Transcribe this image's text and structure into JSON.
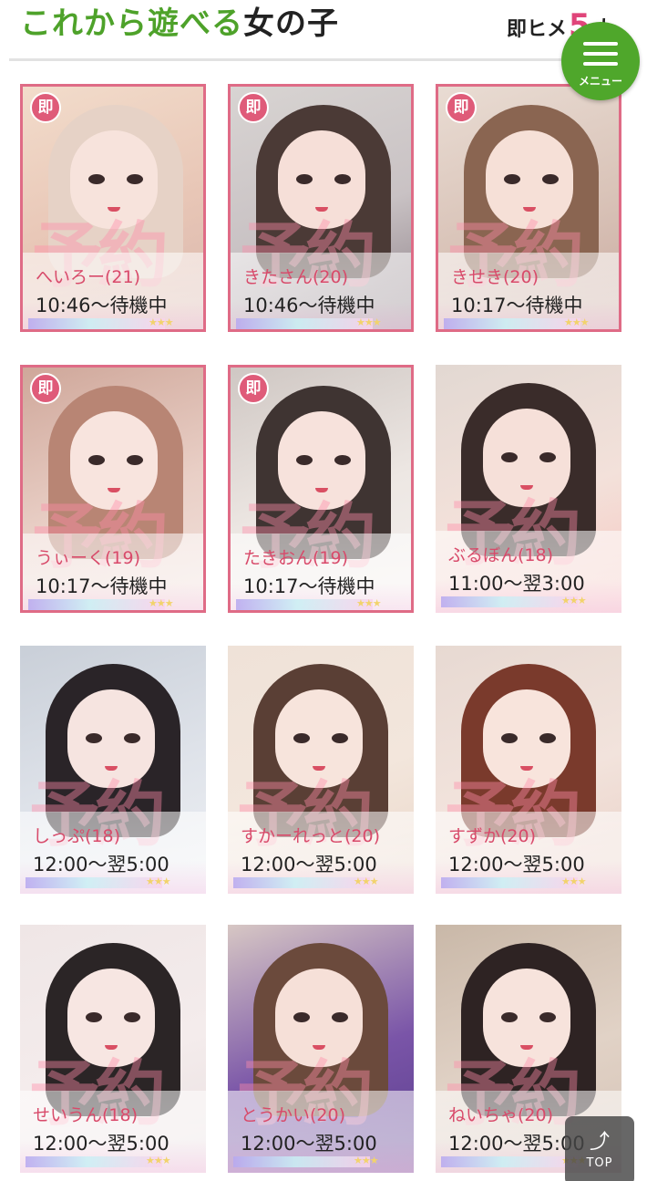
{
  "header": {
    "title_green": "これから遊べる",
    "title_black": "女の子",
    "count_prefix": "即ヒメ",
    "count": "5",
    "count_suffix": "人"
  },
  "menu": {
    "label": "メニュー"
  },
  "badge_label": "即",
  "watermark": "予約",
  "girls": [
    {
      "name": "へいろー(21)",
      "time": "10:46〜待機中",
      "instant": true
    },
    {
      "name": "きたさん(20)",
      "time": "10:46〜待機中",
      "instant": true
    },
    {
      "name": "きせき(20)",
      "time": "10:17〜待機中",
      "instant": true
    },
    {
      "name": "うぃーく(19)",
      "time": "10:17〜待機中",
      "instant": true
    },
    {
      "name": "たきおん(19)",
      "time": "10:17〜待機中",
      "instant": true
    },
    {
      "name": "ぶるぼん(18)",
      "time": "11:00〜翌3:00",
      "instant": false
    },
    {
      "name": "しっぷ(18)",
      "time": "12:00〜翌5:00",
      "instant": false
    },
    {
      "name": "すかーれっと(20)",
      "time": "12:00〜翌5:00",
      "instant": false
    },
    {
      "name": "すずか(20)",
      "time": "12:00〜翌5:00",
      "instant": false
    },
    {
      "name": "せいうん(18)",
      "time": "12:00〜翌5:00",
      "instant": false
    },
    {
      "name": "とうかい(20)",
      "time": "12:00〜翌5:00",
      "instant": false
    },
    {
      "name": "ねいちゃ(20)",
      "time": "12:00〜翌5:00",
      "instant": false
    }
  ],
  "top_button": {
    "label": "TOP"
  }
}
